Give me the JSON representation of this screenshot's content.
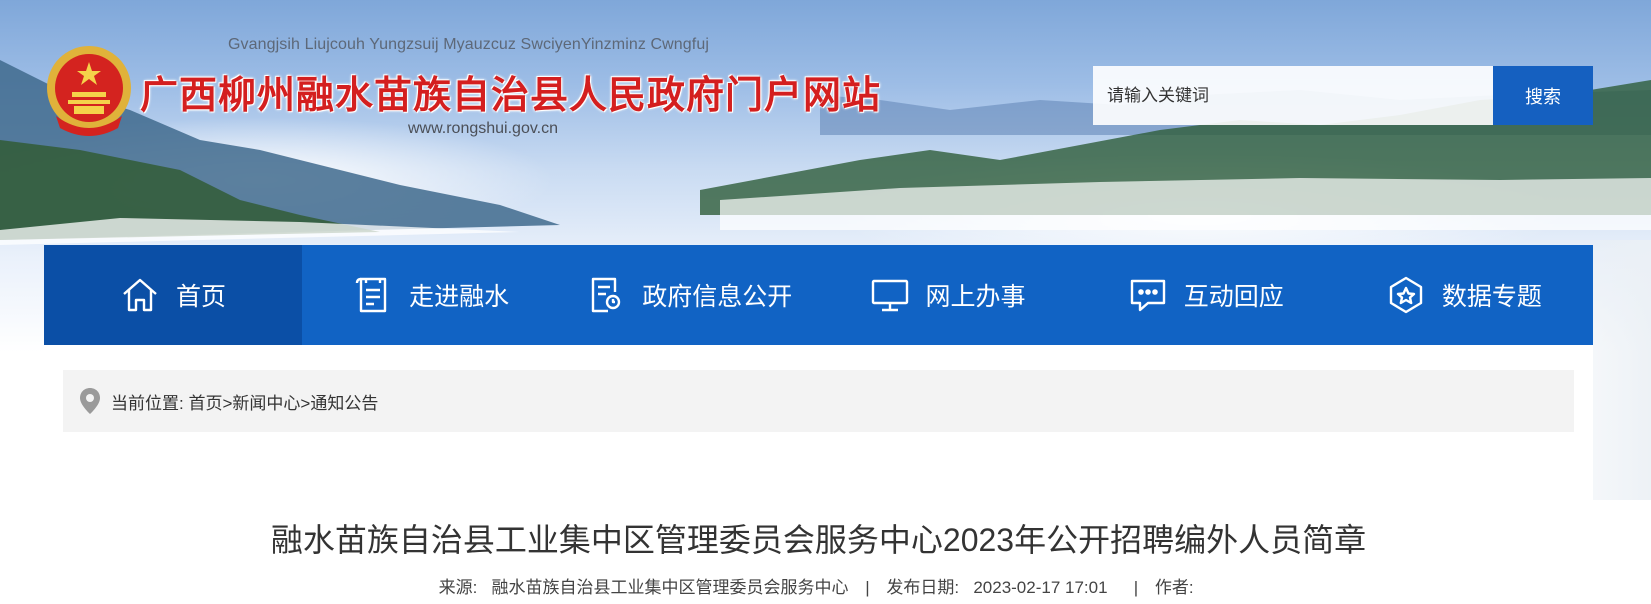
{
  "header": {
    "pinyin": "Gvangjsih Liujcouh  Yungzsuij Myauzcuz SwciyenYinzminz Cwngfuj",
    "title": "广西柳州融水苗族自治县人民政府门户网站",
    "url": "www.rongshui.gov.cn",
    "emblem_icon": "national-emblem-icon"
  },
  "search": {
    "placeholder": "请输入关键词",
    "button_label": "搜索"
  },
  "nav": {
    "items": [
      {
        "label": "首页",
        "icon": "home-icon",
        "active": true
      },
      {
        "label": "走进融水",
        "icon": "document-list-icon"
      },
      {
        "label": "政府信息公开",
        "icon": "document-search-icon"
      },
      {
        "label": "网上办事",
        "icon": "monitor-icon"
      },
      {
        "label": "互动回应",
        "icon": "chat-bubble-icon"
      },
      {
        "label": "数据专题",
        "icon": "badge-star-icon"
      }
    ]
  },
  "breadcrumb": {
    "prefix": "当前位置:",
    "items": [
      "首页",
      "新闻中心",
      "通知公告"
    ],
    "separator": ">"
  },
  "article": {
    "title": "融水苗族自治县工业集中区管理委员会服务中心2023年公开招聘编外人员简章",
    "source_label": "来源:",
    "source_value": "融水苗族自治县工业集中区管理委员会服务中心",
    "date_label": "发布日期:",
    "date_value": "2023-02-17 17:01",
    "author_label": "作者:",
    "author_value": ""
  },
  "colors": {
    "nav_bg": "#1163c4",
    "nav_active_bg": "#0b4fa6",
    "title_red": "#d41f1f",
    "search_button": "#1560c0"
  }
}
